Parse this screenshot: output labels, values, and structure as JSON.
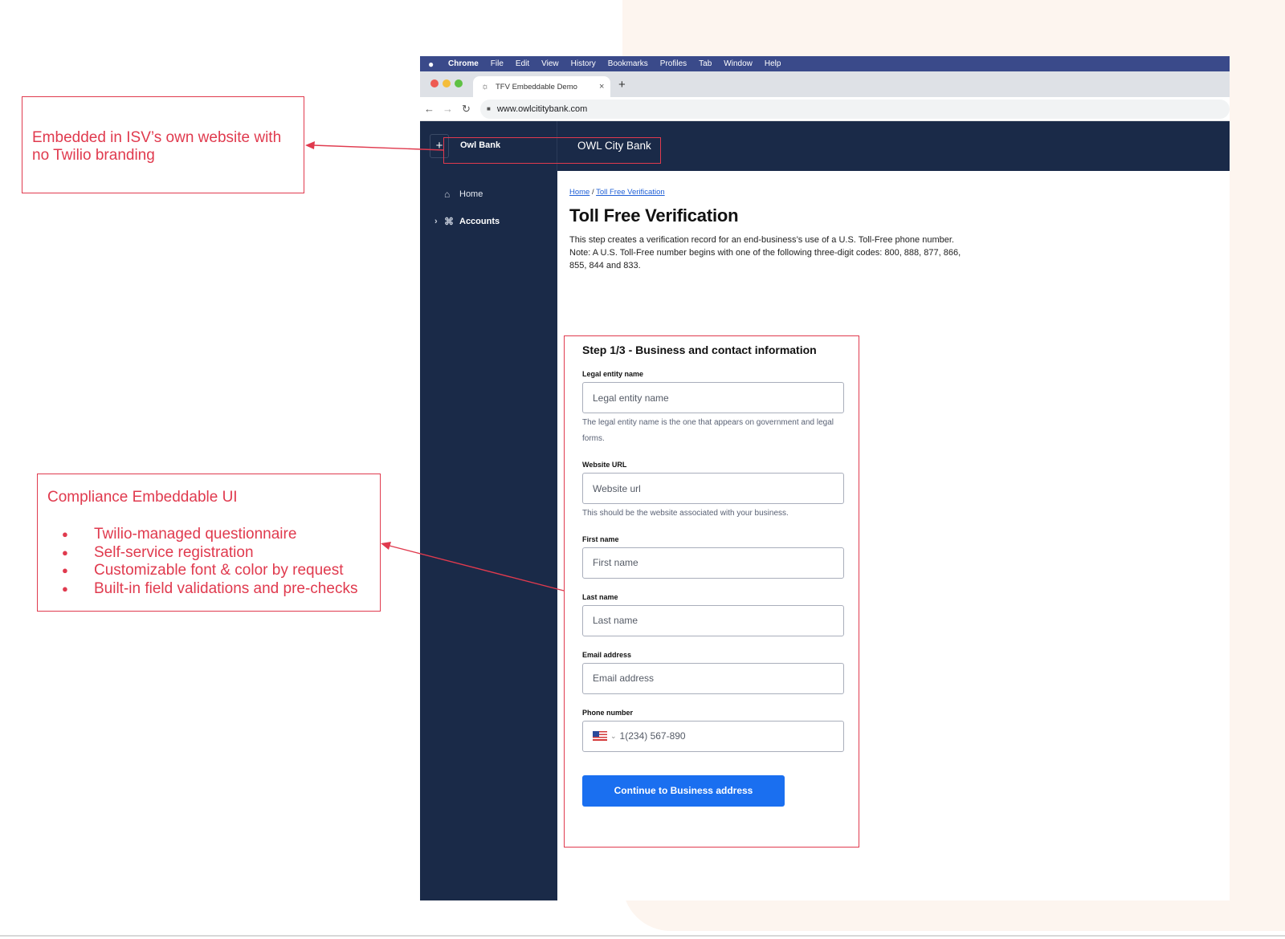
{
  "annotations": {
    "branding_note": "Embedded in ISV’s own website with no Twilio branding",
    "ui_title": "Compliance Embeddable UI",
    "ui_bullets": [
      "Twilio-managed questionnaire",
      "Self-service registration",
      "Customizable font & color by request",
      "Built-in field validations and pre-checks"
    ]
  },
  "os_menubar": {
    "apple_icon": "apple-icon",
    "items": [
      "Chrome",
      "File",
      "Edit",
      "View",
      "History",
      "Bookmarks",
      "Profiles",
      "Tab",
      "Window",
      "Help"
    ]
  },
  "browser": {
    "tab_title": "TFV Embeddable Demo",
    "tab_close": "×",
    "new_tab": "+",
    "url": "www.owlcititybank.com"
  },
  "app": {
    "brand": "Owl Bank",
    "header_title": "OWL City Bank",
    "sidebar": [
      {
        "label": "Home",
        "icon": "home-icon"
      },
      {
        "label": "Accounts",
        "icon": "accounts-icon"
      }
    ],
    "breadcrumb": {
      "home": "Home",
      "separator": "/",
      "current": "Toll Free Verification"
    },
    "page_title": "Toll Free Verification",
    "page_description": "This step creates a verification record for an end-business’s use of a U.S. Toll-Free phone number. Note: A U.S. Toll-Free number begins with one of the following three-digit codes: 800, 888, 877, 866, 855, 844 and 833."
  },
  "form": {
    "step_title": "Step 1/3 - Business and contact information",
    "fields": {
      "legal_entity": {
        "label": "Legal entity name",
        "placeholder": "Legal entity name",
        "help": "The legal entity name is the one that appears on government and legal forms."
      },
      "website": {
        "label": "Website URL",
        "placeholder": "Website url",
        "help": "This should be the website associated with your business."
      },
      "first_name": {
        "label": "First name",
        "placeholder": "First name"
      },
      "last_name": {
        "label": "Last name",
        "placeholder": "Last name"
      },
      "email": {
        "label": "Email address",
        "placeholder": "Email address"
      },
      "phone": {
        "label": "Phone number",
        "placeholder": "1(234) 567-890"
      }
    },
    "submit_label": "Continue to Business address"
  },
  "colors": {
    "annotation_red": "#e03a4e",
    "nav_dark": "#1a2a48",
    "button_blue": "#1a6ff0"
  }
}
